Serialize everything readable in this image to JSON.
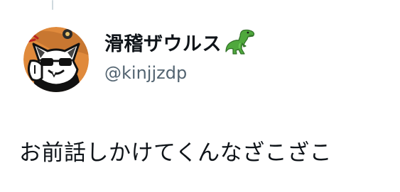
{
  "tweet": {
    "author": {
      "display_name": "滑稽ザウルス",
      "name_emoji_icon": "t-rex-icon",
      "handle": "@kinjjzdp",
      "avatar_icon": "cat-avatar-icon"
    },
    "text": "お前話しかけてくんなざこざこ"
  },
  "colors": {
    "text_primary": "#0f1419",
    "text_secondary": "#536471",
    "thread_line": "#cfd9de",
    "avatar_background": "#e08a3c"
  }
}
